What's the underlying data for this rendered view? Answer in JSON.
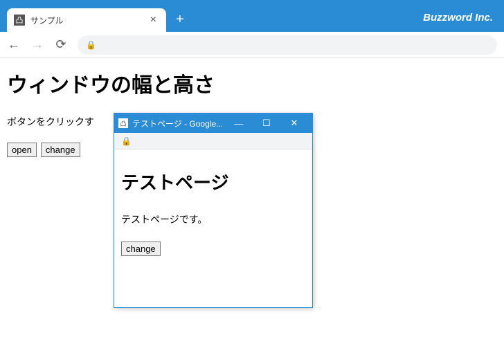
{
  "browser": {
    "tab_title": "サンプル",
    "brand": "Buzzword Inc."
  },
  "main_page": {
    "heading": "ウィンドウの幅と高さ",
    "paragraph": "ボタンをクリックす",
    "open_btn": "open",
    "change_btn": "change"
  },
  "popup": {
    "window_title": "テストページ - Google...",
    "heading": "テストページ",
    "paragraph": "テストページです。",
    "change_btn": "change"
  }
}
